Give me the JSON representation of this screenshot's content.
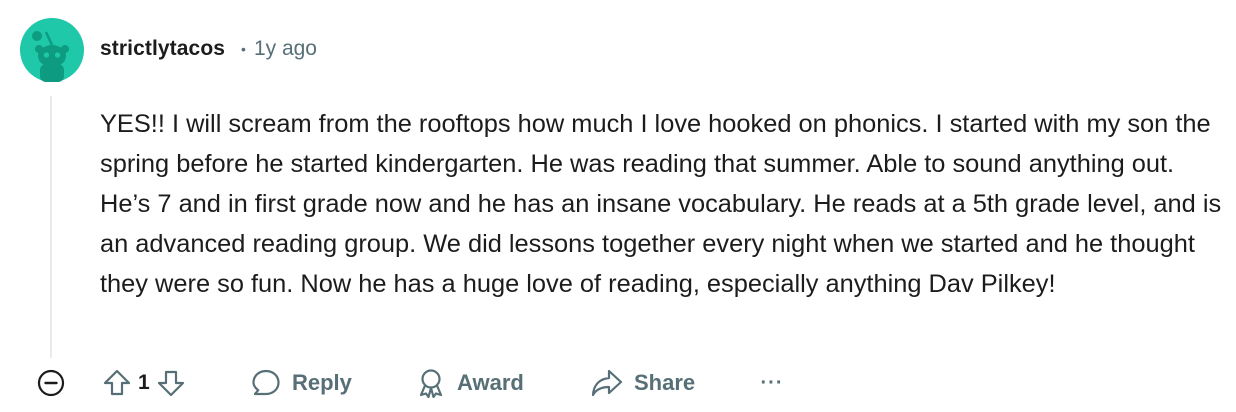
{
  "comment": {
    "author": "strictlytacos",
    "separator": "•",
    "timestamp": "1y ago",
    "body": "YES!! I will scream from the rooftops how much I love hooked on phonics. I started with my son the spring before he started kindergarten. He was reading that summer. Able to sound anything out. He’s 7 and in first grade now and he has an insane vocabulary. He reads at a 5th grade level, and is an advanced reading group. We did lessons together every night when we started and he thought they were so fun. Now he has a huge love of reading, especially anything Dav Pilkey!",
    "avatar_color": "#1fc8a8"
  },
  "actions": {
    "vote_count": "1",
    "reply_label": "Reply",
    "award_label": "Award",
    "share_label": "Share",
    "more_label": "···"
  },
  "icons": {
    "collapse": "minus-circle-icon",
    "upvote": "arrow-up-icon",
    "downvote": "arrow-down-icon",
    "reply": "speech-bubble-icon",
    "award": "award-ribbon-icon",
    "share": "share-arrow-icon",
    "more": "ellipsis-icon"
  }
}
